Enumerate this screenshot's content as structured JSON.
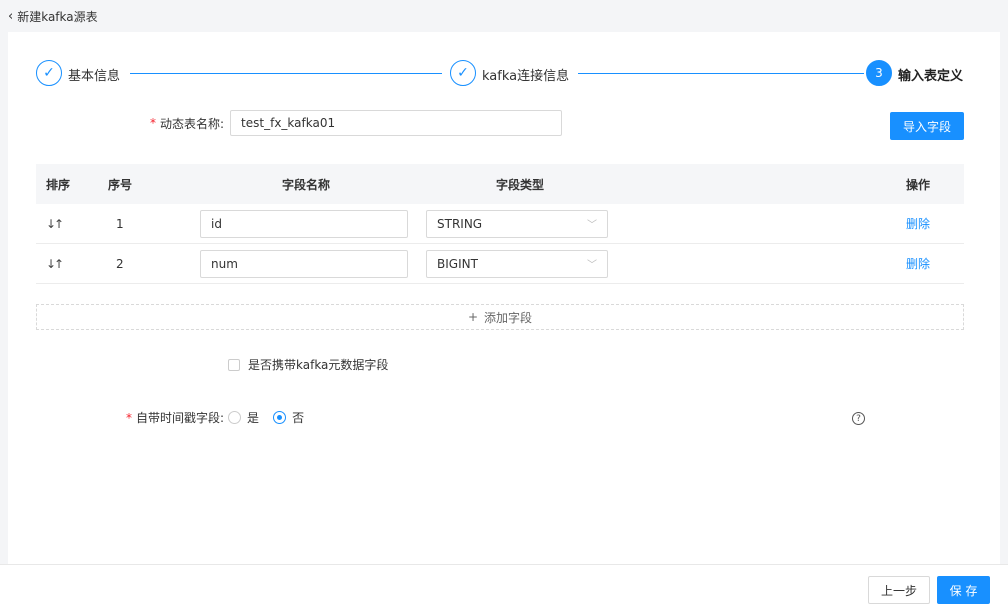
{
  "page": {
    "back_title": "新建kafka源表"
  },
  "steps": [
    {
      "label": "基本信息",
      "state": "done",
      "icon": "check-icon"
    },
    {
      "label": "kafka连接信息",
      "state": "done",
      "icon": "check-icon"
    },
    {
      "number": "3",
      "label": "输入表定义",
      "state": "active"
    }
  ],
  "form": {
    "table_name_label": "动态表名称:",
    "table_name_value": "test_fx_kafka01",
    "import_button": "导入字段"
  },
  "table": {
    "headers": {
      "sort": "排序",
      "index": "序号",
      "field_name": "字段名称",
      "field_type": "字段类型",
      "action": "操作"
    },
    "rows": [
      {
        "index": "1",
        "name": "id",
        "type": "STRING",
        "action": "删除"
      },
      {
        "index": "2",
        "name": "num",
        "type": "BIGINT",
        "action": "删除"
      }
    ],
    "add_label": "添加字段"
  },
  "options": {
    "metadata_checkbox_label": "是否携带kafka元数据字段",
    "timestamp_label": "自带时间戳字段:",
    "radio_yes": "是",
    "radio_no": "否",
    "selected": "否"
  },
  "footer": {
    "prev_button": "上一步",
    "save_button": "保 存"
  },
  "colors": {
    "primary": "#1890ff",
    "required": "#f5222d"
  }
}
